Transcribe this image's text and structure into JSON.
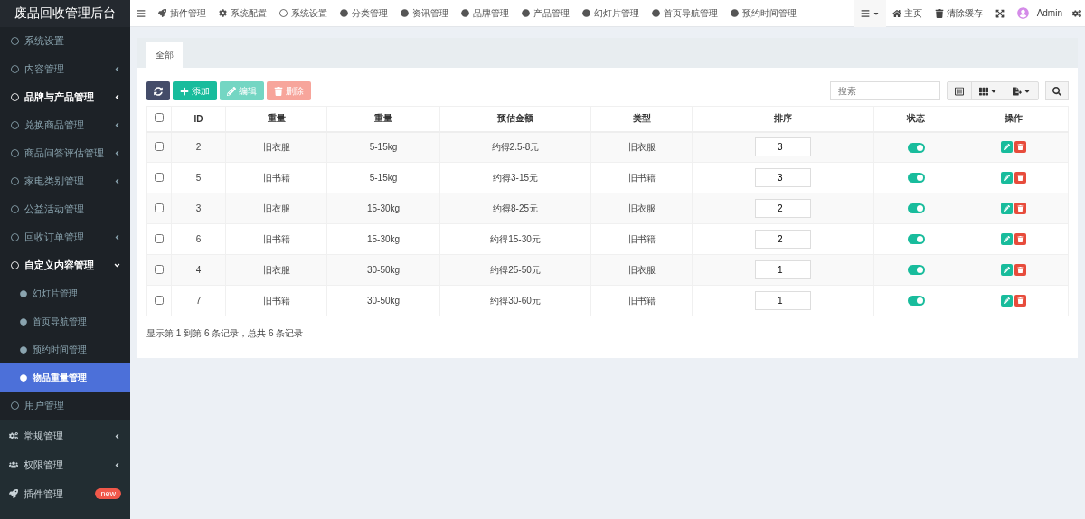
{
  "brand": "废品回收管理后台",
  "sidebar": {
    "menu": [
      {
        "label": "系统设置",
        "highlighted": false
      },
      {
        "label": "内容管理",
        "highlighted": false,
        "expanded": false
      },
      {
        "label": "品牌与产品管理",
        "highlighted": true,
        "expanded": false
      },
      {
        "label": "兑换商品管理",
        "highlighted": false,
        "expanded": false
      },
      {
        "label": "商品问答评估管理",
        "highlighted": false,
        "expanded": false
      },
      {
        "label": "家电类别管理",
        "highlighted": false,
        "expanded": false
      },
      {
        "label": "公益活动管理",
        "highlighted": false
      },
      {
        "label": "回收订单管理",
        "highlighted": false,
        "expanded": false
      },
      {
        "label": "自定义内容管理",
        "highlighted": true,
        "expanded": true,
        "children": [
          {
            "label": "幻灯片管理",
            "selected": false
          },
          {
            "label": "首页导航管理",
            "selected": false
          },
          {
            "label": "预约时间管理",
            "selected": false
          },
          {
            "label": "物品重量管理",
            "selected": true
          }
        ]
      },
      {
        "label": "用户管理",
        "highlighted": false
      }
    ],
    "sections": [
      {
        "label": "常规管理",
        "expanded": false
      },
      {
        "label": "权限管理",
        "expanded": false
      },
      {
        "label": "插件管理",
        "badge": "new"
      }
    ]
  },
  "topnav": {
    "items": [
      "插件管理",
      "系统配置",
      "系统设置",
      "分类管理",
      "资讯管理",
      "品牌管理",
      "产品管理",
      "幻灯片管理",
      "首页导航管理",
      "预约时间管理"
    ],
    "right": [
      "主页",
      "清除缓存"
    ],
    "user": "Admin"
  },
  "tabs": [
    {
      "label": "全部",
      "selected": true
    }
  ],
  "toolbar": {
    "buttons": [
      {
        "kind": "refresh",
        "disabled": false
      },
      {
        "kind": "add",
        "label": "添加",
        "disabled": false
      },
      {
        "kind": "edit",
        "label": "编辑",
        "disabled": true
      },
      {
        "kind": "delete",
        "label": "删除",
        "disabled": true
      }
    ],
    "search": {
      "placeholder": "搜索"
    }
  },
  "table": {
    "header_checked": false,
    "columns": [
      "ID",
      "重量",
      "重量",
      "预估金额",
      "类型",
      "排序",
      "状态",
      "操作"
    ],
    "rows": [
      {
        "checked": false,
        "id": "2",
        "name": "旧衣服",
        "weight": "5-15kg",
        "estimate": "约得2.5-8元",
        "type": "旧衣服",
        "sort": "3",
        "on": true
      },
      {
        "checked": false,
        "id": "5",
        "name": "旧书籍",
        "weight": "5-15kg",
        "estimate": "约得3-15元",
        "type": "旧书籍",
        "sort": "3",
        "on": true
      },
      {
        "checked": false,
        "id": "3",
        "name": "旧衣服",
        "weight": "15-30kg",
        "estimate": "约得8-25元",
        "type": "旧衣服",
        "sort": "2",
        "on": true
      },
      {
        "checked": false,
        "id": "6",
        "name": "旧书籍",
        "weight": "15-30kg",
        "estimate": "约得15-30元",
        "type": "旧书籍",
        "sort": "2",
        "on": true
      },
      {
        "checked": false,
        "id": "4",
        "name": "旧衣服",
        "weight": "30-50kg",
        "estimate": "约得25-50元",
        "type": "旧衣服",
        "sort": "1",
        "on": true
      },
      {
        "checked": false,
        "id": "7",
        "name": "旧书籍",
        "weight": "30-50kg",
        "estimate": "约得30-60元",
        "type": "旧书籍",
        "sort": "1",
        "on": true
      }
    ]
  },
  "footer": "显示第 1 到第 6 条记录，总共 6 条记录"
}
